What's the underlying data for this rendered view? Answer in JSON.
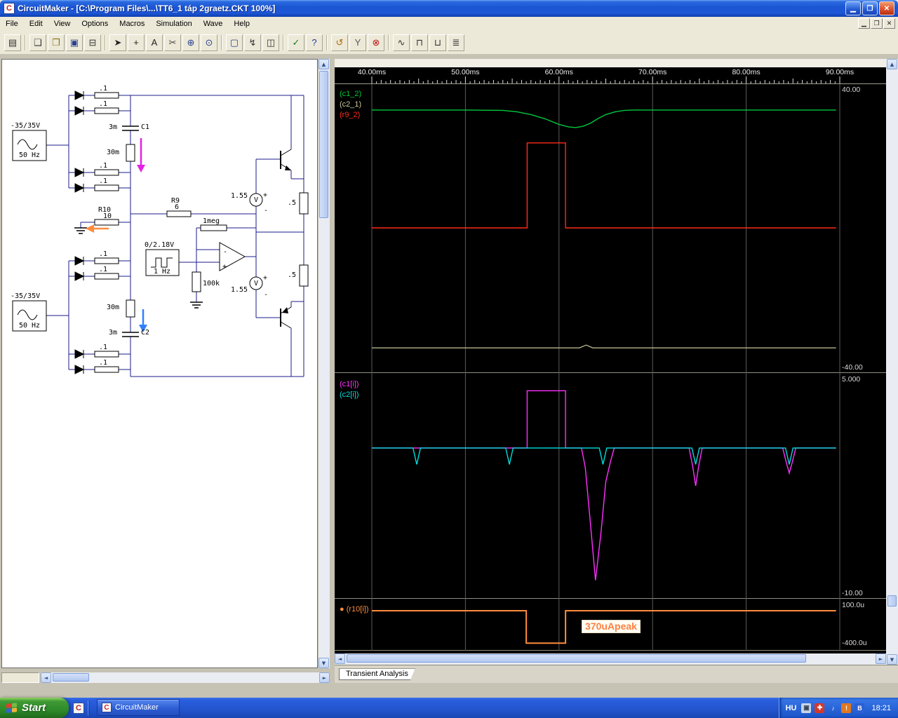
{
  "window": {
    "title": "CircuitMaker - [C:\\Program Files\\...\\TT6_1 táp 2graetz.CKT 100%]"
  },
  "icons": {
    "minimize": "▁",
    "maximize": "❐",
    "close": "✕",
    "mdi_minimize": "▁",
    "mdi_restore": "❐",
    "mdi_close": "✕",
    "app_glyph": "C",
    "trace_bullet": "●",
    "scroll_up": "▲",
    "scroll_down": "▼",
    "scroll_left": "◄",
    "scroll_right": "►"
  },
  "menu": [
    "File",
    "Edit",
    "View",
    "Options",
    "Macros",
    "Simulation",
    "Wave",
    "Help"
  ],
  "toolbar": {
    "groups": [
      [
        {
          "name": "part-browser",
          "glyph": "▤",
          "color": "#333333"
        }
      ],
      [
        {
          "name": "new-file",
          "glyph": "❏",
          "color": "#333333"
        },
        {
          "name": "open-file",
          "glyph": "❐",
          "color": "#8a6d1a"
        },
        {
          "name": "save-file",
          "glyph": "▣",
          "color": "#27408f"
        },
        {
          "name": "print",
          "glyph": "⊟",
          "color": "#333333"
        }
      ],
      [
        {
          "name": "select-tool",
          "glyph": "➤",
          "color": "#222222"
        },
        {
          "name": "wire-tool",
          "glyph": "+",
          "color": "#222222"
        },
        {
          "name": "text-tool",
          "glyph": "A",
          "color": "#222222"
        },
        {
          "name": "delete-tool",
          "glyph": "✂",
          "color": "#444444"
        },
        {
          "name": "zoom-in-tool",
          "glyph": "⊕",
          "color": "#27408f"
        },
        {
          "name": "zoom-tool",
          "glyph": "⊙",
          "color": "#27408f"
        }
      ],
      [
        {
          "name": "zoom-page",
          "glyph": "▢",
          "color": "#27408f"
        },
        {
          "name": "probe-tool",
          "glyph": "↯",
          "color": "#333333"
        },
        {
          "name": "split-view",
          "glyph": "◫",
          "color": "#333333"
        }
      ],
      [
        {
          "name": "run-check",
          "glyph": "✓",
          "color": "#1f7a1f"
        },
        {
          "name": "help",
          "glyph": "?",
          "color": "#1f3a9a"
        }
      ],
      [
        {
          "name": "reset-simulation",
          "glyph": "↺",
          "color": "#b06a00"
        },
        {
          "name": "multimeter",
          "glyph": "Y",
          "color": "#555555"
        },
        {
          "name": "stop-simulation",
          "glyph": "⊗",
          "color": "#c01010"
        }
      ],
      [
        {
          "name": "scope-window-1",
          "glyph": "∿",
          "color": "#333333"
        },
        {
          "name": "scope-window-2",
          "glyph": "⊓",
          "color": "#333333"
        },
        {
          "name": "scope-window-3",
          "glyph": "⊔",
          "color": "#333333"
        },
        {
          "name": "scope-window-4",
          "glyph": "≣",
          "color": "#333333"
        }
      ]
    ]
  },
  "schematic": {
    "labels": {
      "source_voltage": "-35/35V",
      "source_freq": "50 Hz",
      "r_small": ".1",
      "c_big": "3m",
      "c1_name": "C1",
      "c2_name": "C2",
      "r_mid": "30m",
      "r10_name": "R10",
      "r10_value": "10",
      "r9_name": "R9",
      "r9_value": "6",
      "r_feedback": "1meg",
      "pulse_voltage": "0/2.18V",
      "pulse_freq": "1 Hz",
      "r_gain": "100k",
      "v_ref": "1.55",
      "r_load": ".5",
      "plus": "+",
      "minus": "-",
      "v_label": "V"
    }
  },
  "wave": {
    "tab": "Transient Analysis",
    "annotation": "370uApeak",
    "plots": [
      {
        "signals": [
          {
            "label": "(c1_2)",
            "color": "#00c83c"
          },
          {
            "label": "(c2_1)",
            "color": "#c8c89a"
          },
          {
            "label": "(r9_2)",
            "color": "#ff2a1a"
          }
        ],
        "axis_top": "40.00",
        "axis_bottom": "-40.00"
      },
      {
        "signals": [
          {
            "label": "(c1[i])",
            "color": "#ff30ff"
          },
          {
            "label": "(c2[i])",
            "color": "#00dcdc"
          }
        ],
        "axis_top": "5.000",
        "axis_bottom": "-10.00"
      },
      {
        "signals": [
          {
            "label": "(r10[i])",
            "color": "#ff8c3c"
          }
        ],
        "axis_top": "100.0u",
        "axis_bottom": "-400.0u"
      }
    ]
  },
  "chart_data": [
    {
      "type": "line",
      "x_unit": "ms",
      "xlim": [
        40,
        90
      ],
      "x_ticks": [
        40,
        50,
        60,
        70,
        80,
        90
      ],
      "x_tick_labels": [
        "40.00ms",
        "50.00ms",
        "60.00ms",
        "70.00ms",
        "80.00ms",
        "90.00ms"
      ],
      "ylim": [
        -40,
        40
      ],
      "grid": "vertical",
      "y_axis_top_label": "40.00",
      "y_axis_bottom_label": "-40.00",
      "series": [
        {
          "name": "c1_2",
          "color": "#00c83c",
          "width": 1.4,
          "points": [
            [
              40,
              34
            ],
            [
              50,
              34
            ],
            [
              54,
              33.9
            ],
            [
              55.5,
              33.5
            ],
            [
              57,
              32.7
            ],
            [
              58.5,
              31.5
            ],
            [
              60,
              29.9
            ],
            [
              61,
              29.2
            ],
            [
              61.8,
              29
            ],
            [
              62.6,
              29.4
            ],
            [
              63.4,
              30.3
            ],
            [
              64.2,
              31.6
            ],
            [
              65,
              32.7
            ],
            [
              66,
              33.5
            ],
            [
              67,
              33.9
            ],
            [
              68,
              34
            ],
            [
              89.6,
              34
            ]
          ]
        },
        {
          "name": "c2_1",
          "color": "#c8c89a",
          "width": 1.2,
          "points": [
            [
              40,
              -34
            ],
            [
              62.2,
              -34
            ],
            [
              62.9,
              -33.2
            ],
            [
              63.6,
              -34
            ],
            [
              89.6,
              -34
            ]
          ]
        },
        {
          "name": "r9_2",
          "color": "#ff2a1a",
          "width": 1.4,
          "points": [
            [
              40,
              0.3
            ],
            [
              56.6,
              0.3
            ],
            [
              56.6,
              24.6
            ],
            [
              60.7,
              24.6
            ],
            [
              60.7,
              0.3
            ],
            [
              89.6,
              0.3
            ]
          ]
        }
      ]
    },
    {
      "type": "line",
      "x_unit": "ms",
      "xlim": [
        40,
        90
      ],
      "x_ticks": [
        40,
        50,
        60,
        70,
        80,
        90
      ],
      "ylim": [
        -10,
        5
      ],
      "grid": "vertical",
      "y_axis_top_label": "5.000",
      "y_axis_bottom_label": "-10.00",
      "series": [
        {
          "name": "c1[i]",
          "color": "#ff30ff",
          "width": 1.4,
          "points": [
            [
              40,
              0.35
            ],
            [
              56.6,
              0.35
            ],
            [
              56.6,
              4.35
            ],
            [
              60.7,
              4.35
            ],
            [
              60.7,
              0.35
            ],
            [
              62.4,
              0.35
            ],
            [
              62.8,
              -1
            ],
            [
              63.3,
              -4.5
            ],
            [
              63.9,
              -8.9
            ],
            [
              64.5,
              -5.5
            ],
            [
              65,
              -2
            ],
            [
              65.5,
              -0.6
            ],
            [
              65.9,
              0.35
            ],
            [
              73.9,
              0.35
            ],
            [
              74.3,
              -1
            ],
            [
              74.6,
              -2.3
            ],
            [
              74.9,
              -1
            ],
            [
              75.3,
              0.35
            ],
            [
              83.9,
              0.35
            ],
            [
              84.3,
              -0.7
            ],
            [
              84.6,
              -1.4
            ],
            [
              84.9,
              -0.7
            ],
            [
              85.3,
              0.35
            ],
            [
              89.6,
              0.35
            ]
          ]
        },
        {
          "name": "c2[i]",
          "color": "#00dcdc",
          "width": 1.4,
          "points": [
            [
              40,
              0.35
            ],
            [
              44.4,
              0.35
            ],
            [
              44.8,
              -0.8
            ],
            [
              45.2,
              0.35
            ],
            [
              54.3,
              0.35
            ],
            [
              54.7,
              -0.8
            ],
            [
              55.1,
              0.35
            ],
            [
              64.3,
              0.35
            ],
            [
              64.7,
              -0.8
            ],
            [
              65.1,
              0.35
            ],
            [
              74.2,
              0.35
            ],
            [
              74.6,
              -0.8
            ],
            [
              75,
              0.35
            ],
            [
              84.2,
              0.35
            ],
            [
              84.6,
              -0.8
            ],
            [
              85,
              0.35
            ],
            [
              89.6,
              0.35
            ]
          ]
        }
      ]
    },
    {
      "type": "line",
      "x_unit": "ms",
      "xlim": [
        40,
        90
      ],
      "x_ticks": [
        40,
        50,
        60,
        70,
        80,
        90
      ],
      "ylim": [
        -400,
        100
      ],
      "y_unit": "u",
      "grid": "vertical",
      "y_axis_top_label": "100.0u",
      "y_axis_bottom_label": "-400.0u",
      "annotation": "370uApeak",
      "series": [
        {
          "name": "r10[i]",
          "color": "#ff8c3c",
          "width": 2,
          "points": [
            [
              40,
              56
            ],
            [
              56.5,
              56
            ],
            [
              56.5,
              -350
            ],
            [
              60.7,
              -350
            ],
            [
              60.7,
              56
            ],
            [
              89.6,
              56
            ]
          ]
        }
      ]
    }
  ],
  "taskbar": {
    "start_label": "Start",
    "task_label": "CircuitMaker",
    "language": "HU",
    "time": "18:21",
    "tray_icons": [
      {
        "name": "update-icon",
        "glyph": "▣",
        "bg": "#c8d4e8",
        "fg": "#334455"
      },
      {
        "name": "antivirus-icon",
        "glyph": "✚",
        "bg": "#d5382a",
        "fg": "#ffffff"
      },
      {
        "name": "volume-icon",
        "glyph": "♪",
        "bg": "transparent",
        "fg": "#e8eefc"
      },
      {
        "name": "alert-icon",
        "glyph": "!",
        "bg": "#e07820",
        "fg": "#ffffff"
      },
      {
        "name": "bluetooth-icon",
        "glyph": "B",
        "bg": "#2b5fd5",
        "fg": "#ffffff"
      }
    ]
  }
}
